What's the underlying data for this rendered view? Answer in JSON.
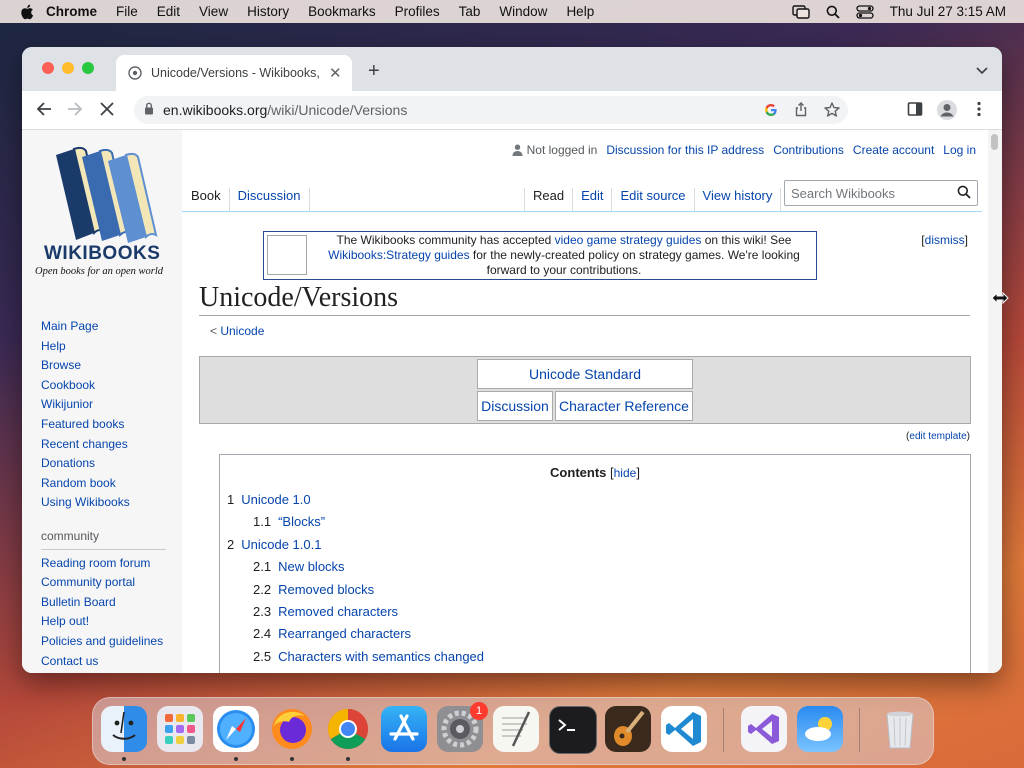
{
  "menubar": {
    "app": "Chrome",
    "items": [
      "File",
      "Edit",
      "View",
      "History",
      "Bookmarks",
      "Profiles",
      "Tab",
      "Window",
      "Help"
    ],
    "clock": "Thu Jul 27  3:15 AM"
  },
  "browser": {
    "tab_title": "Unicode/Versions - Wikibooks, o",
    "url_host": "en.wikibooks.org",
    "url_path": "/wiki/Unicode/Versions"
  },
  "site": {
    "wordmark": "WIKIBOOKS",
    "tagline": "Open books for an open world",
    "nav": [
      "Main Page",
      "Help",
      "Browse",
      "Cookbook",
      "Wikijunior",
      "Featured books",
      "Recent changes",
      "Donations",
      "Random book",
      "Using Wikibooks"
    ],
    "community_heading": "community",
    "community": [
      "Reading room forum",
      "Community portal",
      "Bulletin Board",
      "Help out!",
      "Policies and guidelines",
      "Contact us"
    ]
  },
  "personal": {
    "not_logged_in": "Not logged in",
    "discussion_ip": "Discussion for this IP address",
    "contributions": "Contributions",
    "create_account": "Create account",
    "log_in": "Log in"
  },
  "tabs": {
    "book": "Book",
    "discussion": "Discussion",
    "read": "Read",
    "edit": "Edit",
    "edit_source": "Edit source",
    "view_history": "View history",
    "search_placeholder": "Search Wikibooks"
  },
  "notice": {
    "t1": "The Wikibooks community has accepted ",
    "l1": "video game strategy guides",
    "t2": " on this wiki! See ",
    "l2": "Wikibooks:Strategy guides",
    "t3": " for the newly-created policy on strategy games. We're looking forward to your contributions.",
    "dismiss": "dismiss"
  },
  "article": {
    "title": "Unicode/Versions",
    "crumb_prefix": "< ",
    "crumb_link": "Unicode",
    "navbox": {
      "top": "Unicode Standard",
      "left": "Discussion",
      "right": "Character Reference"
    },
    "edit_template": "edit template",
    "toc": {
      "title": "Contents",
      "hide": "hide",
      "items": [
        {
          "n": "1",
          "label": "Unicode 1.0",
          "lvl": 1
        },
        {
          "n": "1.1",
          "label": "“Blocks”",
          "lvl": 2
        },
        {
          "n": "2",
          "label": "Unicode 1.0.1",
          "lvl": 1
        },
        {
          "n": "2.1",
          "label": "New blocks",
          "lvl": 2
        },
        {
          "n": "2.2",
          "label": "Removed blocks",
          "lvl": 2
        },
        {
          "n": "2.3",
          "label": "Removed characters",
          "lvl": 2
        },
        {
          "n": "2.4",
          "label": "Rearranged characters",
          "lvl": 2
        },
        {
          "n": "2.5",
          "label": "Characters with semantics changed",
          "lvl": 2
        }
      ]
    }
  },
  "dock": {
    "badge": "1",
    "apps": [
      "finder-icon",
      "launchpad-icon",
      "safari-icon",
      "firefox-icon",
      "chrome-icon",
      "app-store-icon",
      "system-settings-icon",
      "textedit-icon",
      "terminal-icon",
      "garageband-icon",
      "vscode-icon",
      "visual-studio-icon",
      "weather-icon",
      "trash-icon"
    ]
  }
}
